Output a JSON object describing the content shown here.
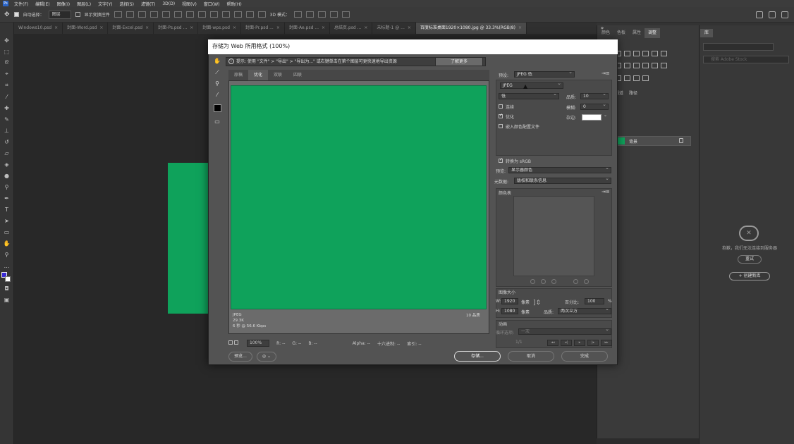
{
  "menubar": {
    "items": [
      "文件(F)",
      "编辑(E)",
      "图像(I)",
      "图层(L)",
      "文字(Y)",
      "选择(S)",
      "滤镜(T)",
      "3D(D)",
      "视图(V)",
      "窗口(W)",
      "帮助(H)"
    ]
  },
  "options": {
    "auto_select": "自动选择：",
    "layer_select": "图层",
    "show_transform": "显示变换控件",
    "mode_3d": "3D 模式："
  },
  "tabs": [
    {
      "label": "Windows10.psd"
    },
    {
      "label": "封面-Word.psd"
    },
    {
      "label": "封面-Excel.psd"
    },
    {
      "label": "封面-Ps.psd ..."
    },
    {
      "label": "封面-wps.psd"
    },
    {
      "label": "封面-Pr.psd ..."
    },
    {
      "label": "封面-Ae.psd ..."
    },
    {
      "label": "总结页.psd ..."
    },
    {
      "label": "未标题-1 @ ..."
    },
    {
      "label": "百度标准桌面1920×1080.jpg @ 33.3%(RGB/8)",
      "active": true
    }
  ],
  "right_panel": {
    "tabs": [
      "颜色",
      "色板",
      "属性",
      "调整"
    ],
    "layers_tabs": [
      "通道",
      "路径"
    ],
    "layer_name": "背景",
    "library_tab": "库",
    "library_search": "搜索 Adobe Stock",
    "library_msg": "抱歉，我们无法连接到服务器",
    "retry": "重试",
    "create_library": "+ 创建新库"
  },
  "dialog": {
    "title": "存储为 Web 所用格式 (100%)",
    "info": "提示: 使用 \"文件\" > \"导出\" > \"导出为...\" 或右键单击在第个图层可更快速地导出资源",
    "learn_more": "了解更多",
    "view_tabs": [
      "原稿",
      "优化",
      "双联",
      "四联"
    ],
    "active_view": "优化",
    "preview_info_1": "JPEG",
    "preview_info_2": "29.3K",
    "preview_info_3": "6 秒 @ 56.6 Kbps",
    "preview_quality": "10 品质",
    "zoom": "100%",
    "status_r": "R: --",
    "status_g": "G: --",
    "status_b": "B: --",
    "status_alpha": "Alpha: --",
    "status_hex": "十六进制: --",
    "status_index": "索引: --",
    "preview_btn": "预览...",
    "save_btn": "存储...",
    "cancel_btn": "取消",
    "done_btn": "完成",
    "preset_label": "预设:",
    "preset_value": "JPEG 低",
    "format_value": "JPEG",
    "compression_value": "低",
    "quality_label": "品质:",
    "quality_value": "10",
    "progressive_label": "连续",
    "blur_label": "模糊:",
    "blur_value": "0",
    "optimized_label": "优化",
    "matte_label": "杂边:",
    "embed_profile_label": "嵌入颜色配置文件",
    "convert_srgb_label": "转换为 sRGB",
    "preview_label": "预览:",
    "preview_value": "显示器颜色",
    "metadata_label": "元数据:",
    "metadata_value": "版权和联系信息",
    "color_table_label": "颜色表",
    "image_size_label": "图像大小",
    "w_label": "W:",
    "w_value": "1920",
    "h_label": "H:",
    "h_value": "1080",
    "px1": "像素",
    "px2": "像素",
    "percent_label": "百分比:",
    "percent_value": "100",
    "percent_unit": "%",
    "quality2_label": "品质:",
    "quality2_value": "两次立方",
    "animation_label": "动画",
    "loop_label": "循环选项:",
    "loop_value": "一次",
    "frame_counter": "1/1"
  }
}
